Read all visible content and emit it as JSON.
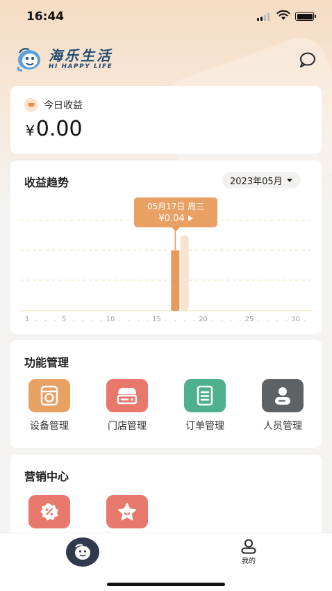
{
  "status_bar": {
    "time": "16:44"
  },
  "header": {
    "brand_cn": "海乐生活",
    "brand_en": "HI HAPPY LIFE",
    "right_icon": "chat-bubble-icon"
  },
  "income_card": {
    "label": "今日收益",
    "currency": "¥",
    "amount": "0.00"
  },
  "trend_card": {
    "title": "收益趋势",
    "month_selector": "2023年05月",
    "tooltip_date": "05月17日 周三",
    "tooltip_value": "¥0.04"
  },
  "chart_data": {
    "type": "bar",
    "x_ticks": [
      "1",
      "5",
      "10",
      "15",
      "20",
      "25",
      "30"
    ],
    "x_range": [
      1,
      31
    ],
    "series": [
      {
        "points": [
          {
            "x": 17,
            "y": 0.04
          }
        ]
      }
    ],
    "highlight": {
      "x": 17,
      "y": 0.04
    },
    "ghost_bar": {
      "x": 18,
      "y": 0.05
    },
    "y_max": 0.06,
    "gridlines": "dashed",
    "colors": {
      "bar": "#e79a5c",
      "ghost_bar": "#f7e3d0",
      "grid": "#ecdcb4"
    }
  },
  "function_card": {
    "title": "功能管理",
    "items": [
      {
        "label": "设备管理",
        "icon": "washing-machine-icon",
        "color": "#e9a063"
      },
      {
        "label": "门店管理",
        "icon": "store-icon",
        "color": "#e9786c"
      },
      {
        "label": "订单管理",
        "icon": "order-list-icon",
        "color": "#4fb08d"
      },
      {
        "label": "人员管理",
        "icon": "person-icon",
        "color": "#5e6265"
      }
    ]
  },
  "marketing_card": {
    "title": "营销中心",
    "items": [
      {
        "icon": "discount-badge-icon",
        "color": "#e9786c"
      },
      {
        "icon": "star-badge-icon",
        "color": "#e9786c"
      }
    ]
  },
  "tab_bar": {
    "home_icon": "mascot-home-icon",
    "me_label": "我的"
  }
}
